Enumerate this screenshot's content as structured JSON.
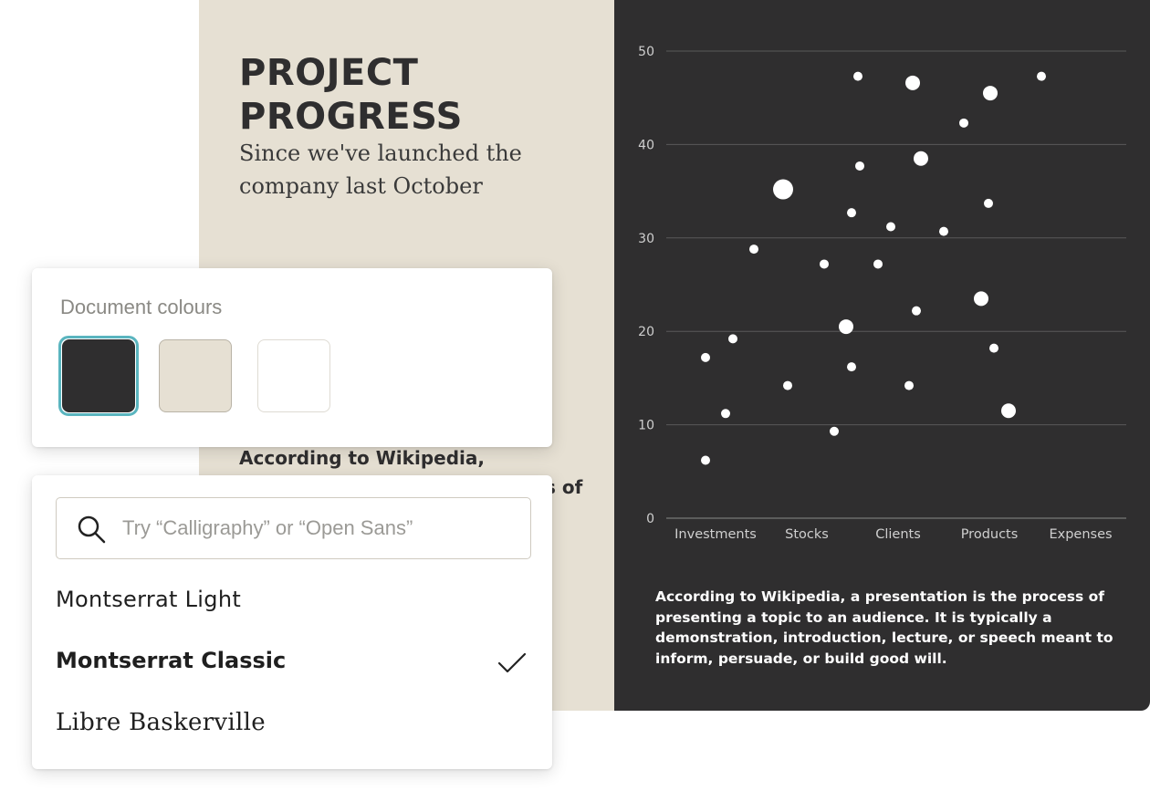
{
  "slide": {
    "title_line1": "PROJECT",
    "title_line2": "PROGRESS",
    "subtitle_line1": "Since we've launched the",
    "subtitle_line2": "company last October",
    "body_visible": "According to Wikipedia,",
    "body_fragment_1": "s of",
    "body_fragment_2": ",",
    "caption": "According to Wikipedia, a presentation is the process of presenting a topic to an audience. It is typically a demonstration, introduction, lecture, or speech meant to inform, persuade, or build good will.",
    "colors": {
      "beige": "#e6e0d3",
      "dark": "#2f2e2f"
    }
  },
  "chart_data": {
    "type": "scatter",
    "categories": [
      "Investments",
      "Stocks",
      "Clients",
      "Products",
      "Expenses"
    ],
    "ylim": [
      0,
      50
    ],
    "yticks": [
      0,
      10,
      20,
      30,
      40,
      50
    ],
    "grid": true,
    "points": [
      {
        "x": 0.39,
        "y": 17.2,
        "size": "small"
      },
      {
        "x": 0.39,
        "y": 6.2,
        "size": "small"
      },
      {
        "x": 0.61,
        "y": 11.2,
        "size": "small"
      },
      {
        "x": 0.69,
        "y": 19.2,
        "size": "small"
      },
      {
        "x": 0.92,
        "y": 28.8,
        "size": "small"
      },
      {
        "x": 1.24,
        "y": 35.2,
        "size": "large"
      },
      {
        "x": 1.29,
        "y": 14.2,
        "size": "small"
      },
      {
        "x": 1.69,
        "y": 27.2,
        "size": "small"
      },
      {
        "x": 1.8,
        "y": 9.3,
        "size": "small"
      },
      {
        "x": 1.93,
        "y": 20.5,
        "size": "medium"
      },
      {
        "x": 1.99,
        "y": 16.2,
        "size": "small"
      },
      {
        "x": 1.99,
        "y": 32.7,
        "size": "small"
      },
      {
        "x": 2.06,
        "y": 47.3,
        "size": "small"
      },
      {
        "x": 2.08,
        "y": 37.7,
        "size": "small"
      },
      {
        "x": 2.28,
        "y": 27.2,
        "size": "small"
      },
      {
        "x": 2.42,
        "y": 31.2,
        "size": "small"
      },
      {
        "x": 2.62,
        "y": 14.2,
        "size": "small"
      },
      {
        "x": 2.66,
        "y": 46.6,
        "size": "medium"
      },
      {
        "x": 2.7,
        "y": 22.2,
        "size": "small"
      },
      {
        "x": 2.75,
        "y": 38.5,
        "size": "medium"
      },
      {
        "x": 3.0,
        "y": 30.7,
        "size": "small"
      },
      {
        "x": 3.22,
        "y": 42.3,
        "size": "small"
      },
      {
        "x": 3.41,
        "y": 23.5,
        "size": "medium"
      },
      {
        "x": 3.49,
        "y": 33.7,
        "size": "small"
      },
      {
        "x": 3.51,
        "y": 45.5,
        "size": "medium"
      },
      {
        "x": 3.55,
        "y": 18.2,
        "size": "small"
      },
      {
        "x": 3.71,
        "y": 11.5,
        "size": "medium"
      },
      {
        "x": 4.07,
        "y": 47.3,
        "size": "small"
      }
    ]
  },
  "colours_panel": {
    "title": "Document colours",
    "swatches": [
      {
        "color": "#2f2e2f",
        "selected": true
      },
      {
        "color": "#e6e0d3",
        "selected": false
      },
      {
        "color": "#ffffff",
        "selected": false
      }
    ],
    "selected_ring_color": "#5ab5bf"
  },
  "font_panel": {
    "search_placeholder": "Try “Calligraphy” or “Open Sans”",
    "search_icon": "search-icon",
    "fonts": [
      {
        "label": "Montserrat Light",
        "selected": false
      },
      {
        "label": "Montserrat Classic",
        "selected": true
      },
      {
        "label": "Libre Baskerville",
        "selected": false
      }
    ],
    "check_icon": "check-icon"
  }
}
